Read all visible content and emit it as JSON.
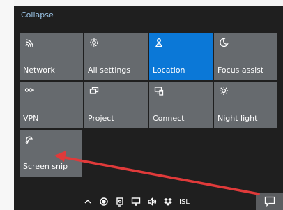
{
  "action_center": {
    "collapse_label": "Collapse",
    "tiles": [
      {
        "label": "Network",
        "icon": "network-icon",
        "active": false
      },
      {
        "label": "All settings",
        "icon": "gear-icon",
        "active": false
      },
      {
        "label": "Location",
        "icon": "location-icon",
        "active": true
      },
      {
        "label": "Focus assist",
        "icon": "moon-icon",
        "active": false
      },
      {
        "label": "VPN",
        "icon": "vpn-icon",
        "active": false
      },
      {
        "label": "Project",
        "icon": "project-icon",
        "active": false
      },
      {
        "label": "Connect",
        "icon": "connect-icon",
        "active": false
      },
      {
        "label": "Night light",
        "icon": "brightness-icon",
        "active": false
      },
      {
        "label": "Screen snip",
        "icon": "screen-snip-icon",
        "active": false
      }
    ]
  },
  "taskbar": {
    "language": "ISL",
    "tray_icons": [
      "chevron-up-icon",
      "record-icon",
      "pen-icon",
      "network-tray-icon",
      "volume-icon",
      "dropbox-icon"
    ]
  },
  "annotation": {
    "arrow_color": "#e03a3a"
  },
  "colors": {
    "tile": "#666a6e",
    "tile_active": "#0b78d7",
    "panel": "#1f1f1f",
    "link": "#9dc7ea"
  }
}
